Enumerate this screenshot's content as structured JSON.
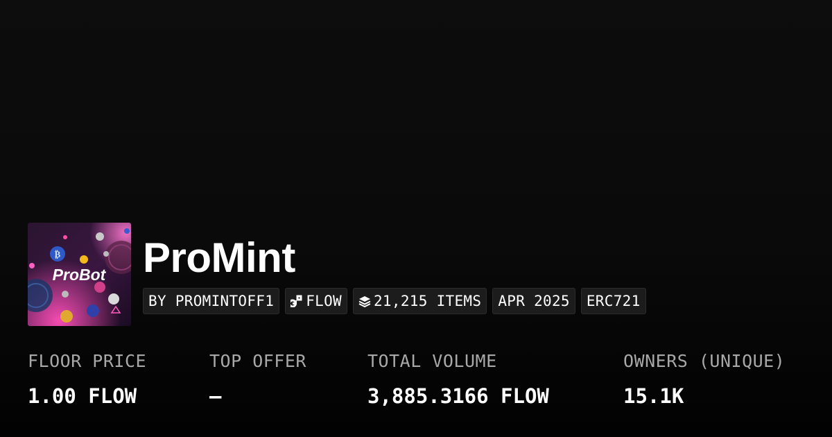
{
  "collection": {
    "name": "ProMint",
    "thumbnail_text": "ProBot"
  },
  "tags": [
    {
      "label": "BY PROMINTOFF1",
      "icon": null
    },
    {
      "label": "FLOW",
      "icon": "flow-chain-icon"
    },
    {
      "label": "21,215 ITEMS",
      "icon": "layers-icon"
    },
    {
      "label": "APR 2025",
      "icon": null
    },
    {
      "label": "ERC721",
      "icon": null
    }
  ],
  "stats": [
    {
      "label": "FLOOR PRICE",
      "value": "1.00 FLOW"
    },
    {
      "label": "TOP OFFER",
      "value": "—"
    },
    {
      "label": "TOTAL VOLUME",
      "value": "3,885.3166 FLOW"
    },
    {
      "label": "OWNERS (UNIQUE)",
      "value": "15.1K"
    }
  ],
  "colors": {
    "background": "#0b0b0b",
    "tag_background": "#1c1c1c",
    "label_gray": "#a8a8a8",
    "thumbnail_accent": "#e23aa0"
  }
}
